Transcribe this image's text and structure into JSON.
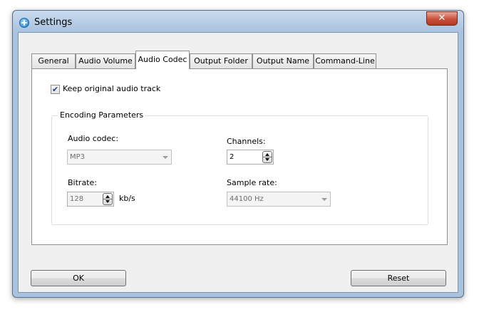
{
  "window": {
    "title": "Settings",
    "close_glyph": "✕"
  },
  "tabs": [
    {
      "label": "General",
      "active": false
    },
    {
      "label": "Audio Volume",
      "active": false
    },
    {
      "label": "Audio Codec",
      "active": true
    },
    {
      "label": "Output Folder",
      "active": false
    },
    {
      "label": "Output Name",
      "active": false
    },
    {
      "label": "Command-Line",
      "active": false
    }
  ],
  "keep_track": {
    "label": "Keep original audio track",
    "checked": true,
    "glyph": "✔"
  },
  "encoding": {
    "group_title": "Encoding Parameters",
    "audio_codec": {
      "label": "Audio codec:",
      "value": "MP3"
    },
    "channels": {
      "label": "Channels:",
      "value": "2"
    },
    "bitrate": {
      "label": "Bitrate:",
      "value": "128",
      "unit": "kb/s"
    },
    "sample_rate": {
      "label": "Sample rate:",
      "value": "44100 Hz"
    }
  },
  "buttons": {
    "ok": "OK",
    "reset": "Reset"
  },
  "colors": {
    "title_bar": "#a9c2de",
    "close": "#c7503a",
    "panel": "#ffffff",
    "dialog": "#f0f0f0"
  }
}
